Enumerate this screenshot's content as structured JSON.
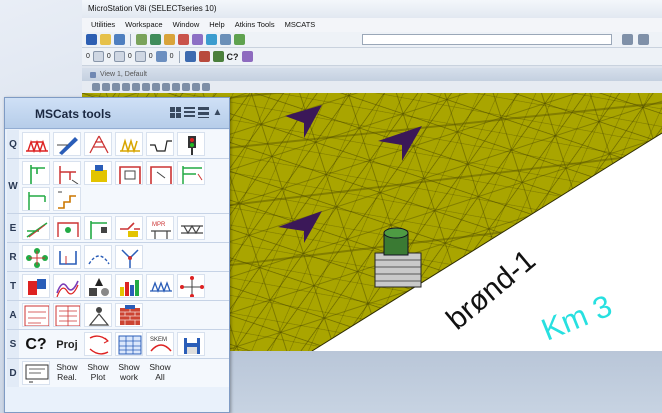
{
  "window": {
    "title": "MicroStation V8i (SELECTseries 10)",
    "menu": [
      "Utilities",
      "Workspace",
      "Window",
      "Help",
      "Atkins Tools",
      "MSCATS"
    ],
    "cmd_label": "C?"
  },
  "toolbar_rows": {
    "row2_values": [
      "0",
      "0",
      "0",
      "0",
      "0"
    ]
  },
  "view": {
    "title": "View 1, Default",
    "labels": {
      "well": "brønd-1",
      "km": "Km 3"
    },
    "colors": {
      "terrain": "#a7a400",
      "markers": "#3b1858",
      "km_text": "#27e0e0"
    }
  },
  "panel": {
    "title": "MSCats tools",
    "rows": [
      {
        "letter": "Q",
        "tools": [
          "q-tool-1",
          "q-tool-2",
          "q-tool-3",
          "q-tool-4",
          "q-tool-5",
          "q-tool-6"
        ]
      },
      {
        "letter": "W",
        "tools": [
          "w-tool-1",
          "w-tool-2",
          "w-tool-3",
          "w-tool-4",
          "w-tool-5",
          "w-tool-6",
          "w-tool-7",
          "w-tool-8"
        ]
      },
      {
        "letter": "E",
        "tools": [
          "e-tool-1",
          "e-tool-2",
          "e-tool-3",
          "e-tool-4",
          "e-tool-5",
          "e-tool-6"
        ]
      },
      {
        "letter": "R",
        "tools": [
          "r-tool-1",
          "r-tool-2",
          "r-tool-3",
          "r-tool-4"
        ]
      },
      {
        "letter": "T",
        "tools": [
          "t-tool-1",
          "t-tool-2",
          "t-tool-3",
          "t-tool-4",
          "t-tool-5",
          "t-tool-6"
        ]
      },
      {
        "letter": "A",
        "tools": [
          "a-tool-1",
          "a-tool-2",
          "a-tool-3",
          "a-tool-4"
        ]
      },
      {
        "letter": "S",
        "cmd": "C?",
        "proj": "Proj",
        "tools": [
          "s-tool-1",
          "s-tool-2",
          "s-tool-3",
          "s-tool-4"
        ]
      },
      {
        "letter": "D",
        "show": [
          {
            "l1": "Show",
            "l2": "Real."
          },
          {
            "l1": "Show",
            "l2": "Plot"
          },
          {
            "l1": "Show",
            "l2": "work"
          },
          {
            "l1": "Show",
            "l2": "All"
          }
        ]
      }
    ]
  }
}
